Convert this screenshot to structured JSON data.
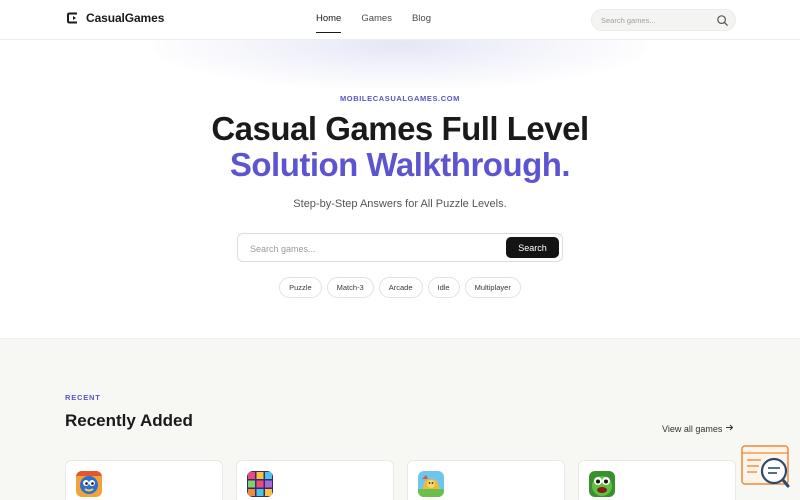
{
  "header": {
    "brand": "CasualGames",
    "nav": [
      {
        "label": "Home",
        "active": true
      },
      {
        "label": "Games",
        "active": false
      },
      {
        "label": "Blog",
        "active": false
      }
    ],
    "search_placeholder": "Search games..."
  },
  "hero": {
    "eyebrow": "MOBILECASUALGAMES.COM",
    "title_line1": "Casual Games Full Level",
    "title_line2": "Solution Walkthrough.",
    "subtitle": "Step-by-Step Answers for All Puzzle Levels.",
    "search_placeholder": "Search games...",
    "search_button": "Search",
    "chips": [
      "Puzzle",
      "Match-3",
      "Arcade",
      "Idle",
      "Multiplayer"
    ]
  },
  "recent": {
    "eyebrow": "RECENT",
    "title": "Recently Added",
    "view_all": "View all games"
  },
  "colors": {
    "accent": "#5c55cf",
    "dark": "#141414",
    "section_bg": "#f7f7f3"
  },
  "icons": {
    "logo": "casualgames-logo-icon",
    "search": "search-icon",
    "arrow": "arrow-right-icon",
    "help": "chat-help-icon"
  }
}
